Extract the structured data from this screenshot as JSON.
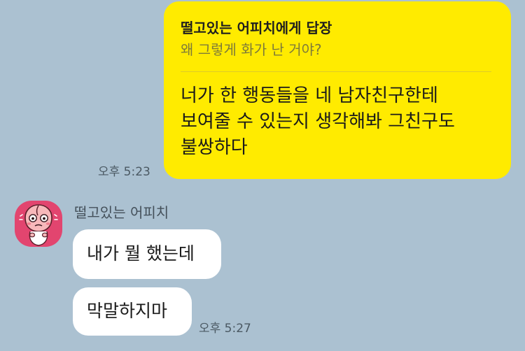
{
  "reply": {
    "title": "떨고있는 어피치에게 답장",
    "quoted": "왜 그렇게 화가 난 거야?",
    "body": "너가 한 행동들을 네 남자친구한테 보여줄 수 있는지 생각해봐 그친구도 불쌍하다",
    "time": "오후 5:23"
  },
  "incoming": {
    "sender": "떨고있는 어피치",
    "avatar_icon": "apeach-profile-icon",
    "messages": [
      {
        "text": "내가 뭘 했는데"
      },
      {
        "text": "막말하지마"
      }
    ],
    "time": "오후 5:27"
  },
  "colors": {
    "background": "#abc1d1",
    "outgoing_bubble": "#ffeb00",
    "incoming_bubble": "#ffffff",
    "avatar_bg": "#e2456f"
  }
}
